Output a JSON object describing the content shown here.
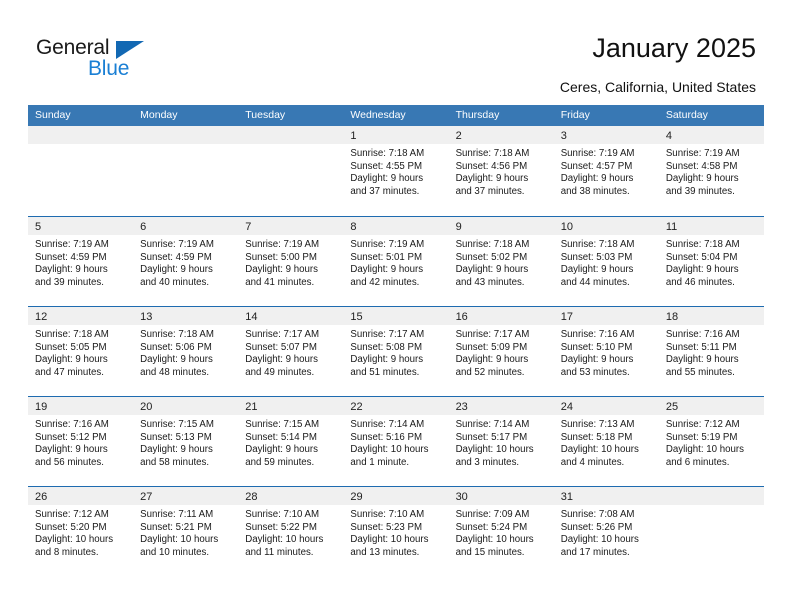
{
  "branding": {
    "logo_text_primary": "General",
    "logo_text_secondary": "Blue",
    "accent_color": "#1268b3",
    "secondary_color": "#1a7fd4"
  },
  "header": {
    "title": "January 2025",
    "location": "Ceres, California, United States"
  },
  "calendar": {
    "header_bg": "#3878b4",
    "daynum_bg": "#f0f0f0",
    "row_separator_color": "#1e6bb0",
    "weekday_headers": [
      "Sunday",
      "Monday",
      "Tuesday",
      "Wednesday",
      "Thursday",
      "Friday",
      "Saturday"
    ],
    "weeks": [
      [
        {
          "day": "",
          "lines": []
        },
        {
          "day": "",
          "lines": []
        },
        {
          "day": "",
          "lines": []
        },
        {
          "day": "1",
          "lines": [
            "Sunrise: 7:18 AM",
            "Sunset: 4:55 PM",
            "Daylight: 9 hours",
            "and 37 minutes."
          ]
        },
        {
          "day": "2",
          "lines": [
            "Sunrise: 7:18 AM",
            "Sunset: 4:56 PM",
            "Daylight: 9 hours",
            "and 37 minutes."
          ]
        },
        {
          "day": "3",
          "lines": [
            "Sunrise: 7:19 AM",
            "Sunset: 4:57 PM",
            "Daylight: 9 hours",
            "and 38 minutes."
          ]
        },
        {
          "day": "4",
          "lines": [
            "Sunrise: 7:19 AM",
            "Sunset: 4:58 PM",
            "Daylight: 9 hours",
            "and 39 minutes."
          ]
        }
      ],
      [
        {
          "day": "5",
          "lines": [
            "Sunrise: 7:19 AM",
            "Sunset: 4:59 PM",
            "Daylight: 9 hours",
            "and 39 minutes."
          ]
        },
        {
          "day": "6",
          "lines": [
            "Sunrise: 7:19 AM",
            "Sunset: 4:59 PM",
            "Daylight: 9 hours",
            "and 40 minutes."
          ]
        },
        {
          "day": "7",
          "lines": [
            "Sunrise: 7:19 AM",
            "Sunset: 5:00 PM",
            "Daylight: 9 hours",
            "and 41 minutes."
          ]
        },
        {
          "day": "8",
          "lines": [
            "Sunrise: 7:19 AM",
            "Sunset: 5:01 PM",
            "Daylight: 9 hours",
            "and 42 minutes."
          ]
        },
        {
          "day": "9",
          "lines": [
            "Sunrise: 7:18 AM",
            "Sunset: 5:02 PM",
            "Daylight: 9 hours",
            "and 43 minutes."
          ]
        },
        {
          "day": "10",
          "lines": [
            "Sunrise: 7:18 AM",
            "Sunset: 5:03 PM",
            "Daylight: 9 hours",
            "and 44 minutes."
          ]
        },
        {
          "day": "11",
          "lines": [
            "Sunrise: 7:18 AM",
            "Sunset: 5:04 PM",
            "Daylight: 9 hours",
            "and 46 minutes."
          ]
        }
      ],
      [
        {
          "day": "12",
          "lines": [
            "Sunrise: 7:18 AM",
            "Sunset: 5:05 PM",
            "Daylight: 9 hours",
            "and 47 minutes."
          ]
        },
        {
          "day": "13",
          "lines": [
            "Sunrise: 7:18 AM",
            "Sunset: 5:06 PM",
            "Daylight: 9 hours",
            "and 48 minutes."
          ]
        },
        {
          "day": "14",
          "lines": [
            "Sunrise: 7:17 AM",
            "Sunset: 5:07 PM",
            "Daylight: 9 hours",
            "and 49 minutes."
          ]
        },
        {
          "day": "15",
          "lines": [
            "Sunrise: 7:17 AM",
            "Sunset: 5:08 PM",
            "Daylight: 9 hours",
            "and 51 minutes."
          ]
        },
        {
          "day": "16",
          "lines": [
            "Sunrise: 7:17 AM",
            "Sunset: 5:09 PM",
            "Daylight: 9 hours",
            "and 52 minutes."
          ]
        },
        {
          "day": "17",
          "lines": [
            "Sunrise: 7:16 AM",
            "Sunset: 5:10 PM",
            "Daylight: 9 hours",
            "and 53 minutes."
          ]
        },
        {
          "day": "18",
          "lines": [
            "Sunrise: 7:16 AM",
            "Sunset: 5:11 PM",
            "Daylight: 9 hours",
            "and 55 minutes."
          ]
        }
      ],
      [
        {
          "day": "19",
          "lines": [
            "Sunrise: 7:16 AM",
            "Sunset: 5:12 PM",
            "Daylight: 9 hours",
            "and 56 minutes."
          ]
        },
        {
          "day": "20",
          "lines": [
            "Sunrise: 7:15 AM",
            "Sunset: 5:13 PM",
            "Daylight: 9 hours",
            "and 58 minutes."
          ]
        },
        {
          "day": "21",
          "lines": [
            "Sunrise: 7:15 AM",
            "Sunset: 5:14 PM",
            "Daylight: 9 hours",
            "and 59 minutes."
          ]
        },
        {
          "day": "22",
          "lines": [
            "Sunrise: 7:14 AM",
            "Sunset: 5:16 PM",
            "Daylight: 10 hours",
            "and 1 minute."
          ]
        },
        {
          "day": "23",
          "lines": [
            "Sunrise: 7:14 AM",
            "Sunset: 5:17 PM",
            "Daylight: 10 hours",
            "and 3 minutes."
          ]
        },
        {
          "day": "24",
          "lines": [
            "Sunrise: 7:13 AM",
            "Sunset: 5:18 PM",
            "Daylight: 10 hours",
            "and 4 minutes."
          ]
        },
        {
          "day": "25",
          "lines": [
            "Sunrise: 7:12 AM",
            "Sunset: 5:19 PM",
            "Daylight: 10 hours",
            "and 6 minutes."
          ]
        }
      ],
      [
        {
          "day": "26",
          "lines": [
            "Sunrise: 7:12 AM",
            "Sunset: 5:20 PM",
            "Daylight: 10 hours",
            "and 8 minutes."
          ]
        },
        {
          "day": "27",
          "lines": [
            "Sunrise: 7:11 AM",
            "Sunset: 5:21 PM",
            "Daylight: 10 hours",
            "and 10 minutes."
          ]
        },
        {
          "day": "28",
          "lines": [
            "Sunrise: 7:10 AM",
            "Sunset: 5:22 PM",
            "Daylight: 10 hours",
            "and 11 minutes."
          ]
        },
        {
          "day": "29",
          "lines": [
            "Sunrise: 7:10 AM",
            "Sunset: 5:23 PM",
            "Daylight: 10 hours",
            "and 13 minutes."
          ]
        },
        {
          "day": "30",
          "lines": [
            "Sunrise: 7:09 AM",
            "Sunset: 5:24 PM",
            "Daylight: 10 hours",
            "and 15 minutes."
          ]
        },
        {
          "day": "31",
          "lines": [
            "Sunrise: 7:08 AM",
            "Sunset: 5:26 PM",
            "Daylight: 10 hours",
            "and 17 minutes."
          ]
        },
        {
          "day": "",
          "lines": []
        }
      ]
    ]
  }
}
